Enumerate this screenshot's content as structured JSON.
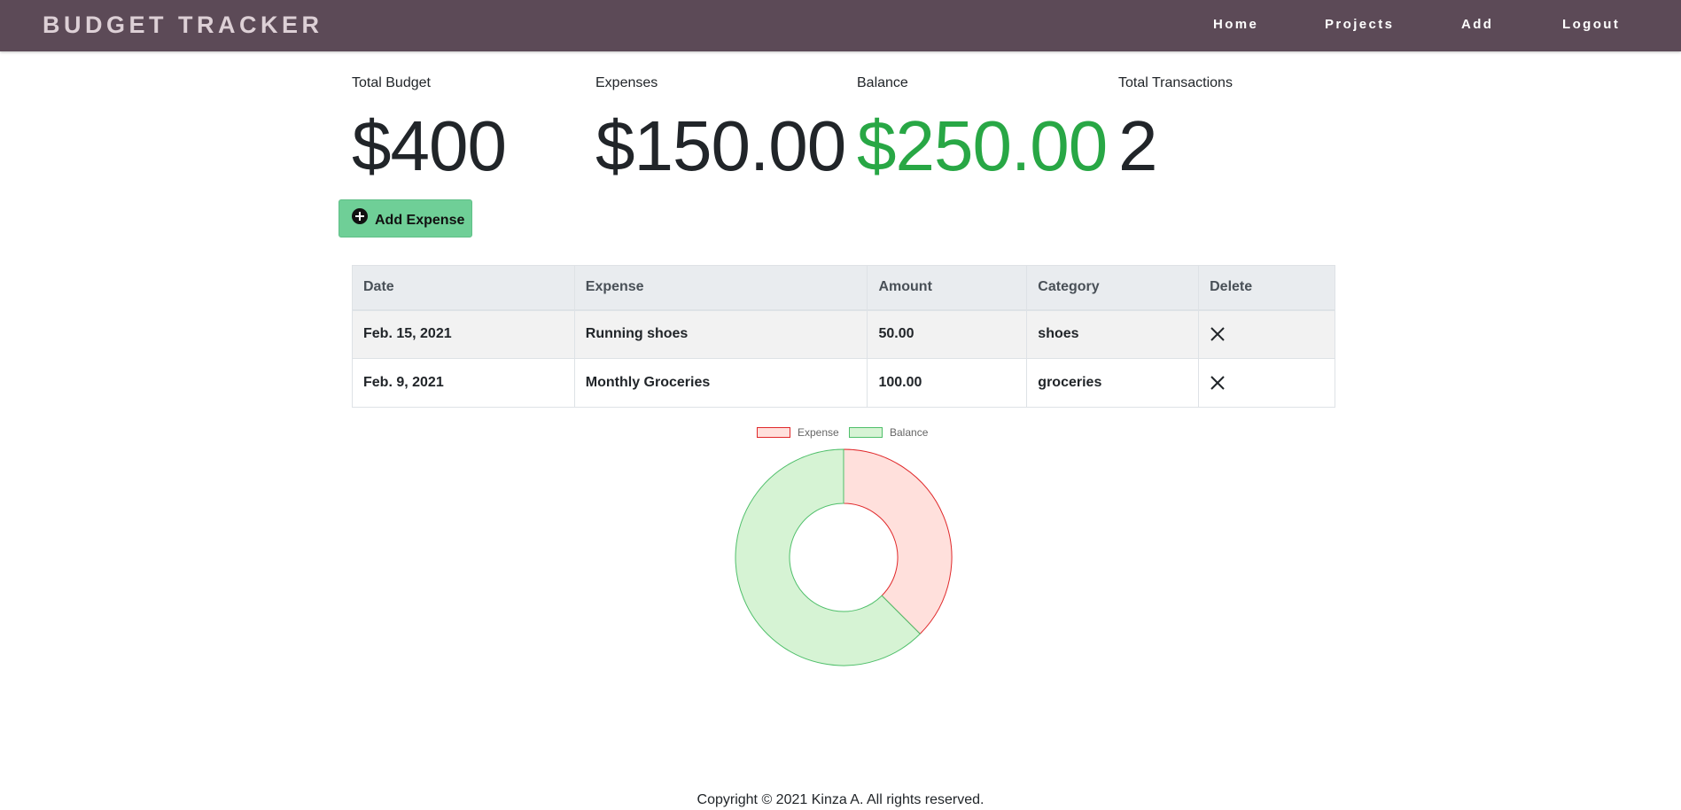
{
  "navbar": {
    "brand": "BUDGET TRACKER",
    "links": [
      "Home",
      "Projects",
      "Add",
      "Logout"
    ]
  },
  "stats": {
    "total_budget_label": "Total Budget",
    "total_budget_value": "$400",
    "expenses_label": "Expenses",
    "expenses_value": "$150.00",
    "balance_label": "Balance",
    "balance_value": "$250.00",
    "transactions_label": "Total Transactions",
    "transactions_value": "2"
  },
  "add_button": {
    "label": "Add Expense",
    "icon": "plus-circle-icon"
  },
  "table": {
    "headers": [
      "Date",
      "Expense",
      "Amount",
      "Category",
      "Delete"
    ],
    "rows": [
      {
        "date": "Feb. 15, 2021",
        "expense": "Running shoes",
        "amount": "50.00",
        "category": "shoes"
      },
      {
        "date": "Feb. 9, 2021",
        "expense": "Monthly Groceries",
        "amount": "100.00",
        "category": "groceries"
      }
    ],
    "delete_icon": "close-icon"
  },
  "chart_data": {
    "type": "pie",
    "categories": [
      "Expense",
      "Balance"
    ],
    "values": [
      150,
      250
    ],
    "colors": {
      "Expense": {
        "fill": "#ffe0dc",
        "stroke": "#e0282a"
      },
      "Balance": {
        "fill": "#d6f3d4",
        "stroke": "#4fbf6a"
      }
    },
    "legend": "top"
  },
  "colors": {
    "navbar_bg": "#5c4a57",
    "brand_text": "#ddd0d6",
    "balance_green": "#28a745",
    "add_button_bg": "#6fcf97"
  },
  "footer": {
    "text": "Copyright © 2021 Kinza A. All rights reserved."
  }
}
